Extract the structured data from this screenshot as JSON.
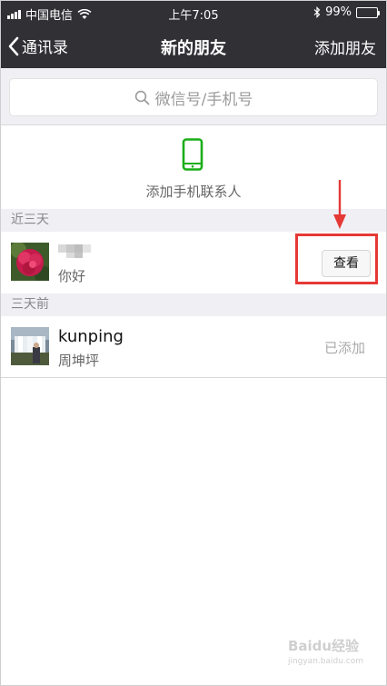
{
  "status_bar": {
    "carrier": "中国电信",
    "time": "上午7:05",
    "battery": "99%",
    "battery_level": 0.99
  },
  "nav": {
    "back_label": "通讯录",
    "title": "新的朋友",
    "action_label": "添加朋友"
  },
  "search": {
    "placeholder": "微信号/手机号"
  },
  "add_contacts": {
    "label": "添加手机联系人"
  },
  "sections": [
    {
      "header": "近三天",
      "items": [
        {
          "name": "",
          "subtitle": "你好",
          "action": "查看"
        }
      ]
    },
    {
      "header": "三天前",
      "items": [
        {
          "name": "kunping",
          "subtitle": "周坤坪",
          "status": "已添加"
        }
      ]
    }
  ],
  "colors": {
    "nav_bg": "#303035",
    "page_bg": "#efeff4",
    "accent_green": "#1aad19",
    "highlight_red": "#e53935"
  },
  "watermark": {
    "brand": "Baidu经验",
    "url": "jingyan.baidu.com"
  }
}
